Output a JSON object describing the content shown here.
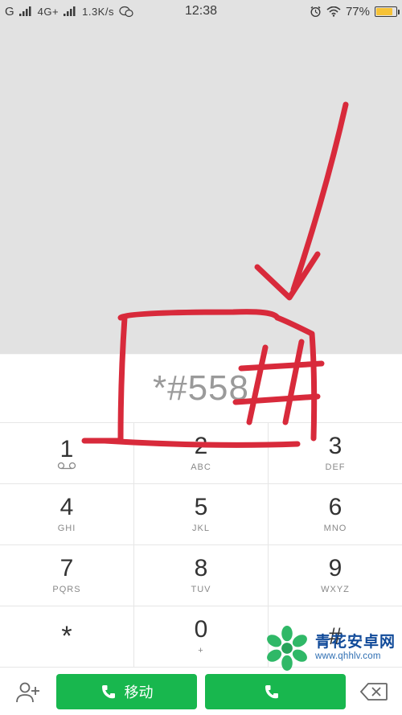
{
  "status": {
    "carrier_prefix": "G",
    "network_mode": "4G+",
    "data_speed": "1.3K/s",
    "time": "12:38",
    "battery_percent": "77%"
  },
  "dialer": {
    "entered_value": "*#558"
  },
  "keys": {
    "r1": [
      {
        "digit": "1",
        "sub": ""
      },
      {
        "digit": "2",
        "sub": "ABC"
      },
      {
        "digit": "3",
        "sub": "DEF"
      }
    ],
    "r2": [
      {
        "digit": "4",
        "sub": "GHI"
      },
      {
        "digit": "5",
        "sub": "JKL"
      },
      {
        "digit": "6",
        "sub": "MNO"
      }
    ],
    "r3": [
      {
        "digit": "7",
        "sub": "PQRS"
      },
      {
        "digit": "8",
        "sub": "TUV"
      },
      {
        "digit": "9",
        "sub": "WXYZ"
      }
    ],
    "r4": [
      {
        "digit": "*",
        "sub": ""
      },
      {
        "digit": "0",
        "sub": "+"
      },
      {
        "digit": "#",
        "sub": ""
      }
    ]
  },
  "bottom": {
    "call_sim1_label": "移动",
    "call_sim2_label": ""
  },
  "watermark": {
    "line1": "青花安卓网",
    "line2": "www.qhhlv.com"
  },
  "annotation": {
    "highlighted_text": "#",
    "box_target": "dialed number row"
  }
}
